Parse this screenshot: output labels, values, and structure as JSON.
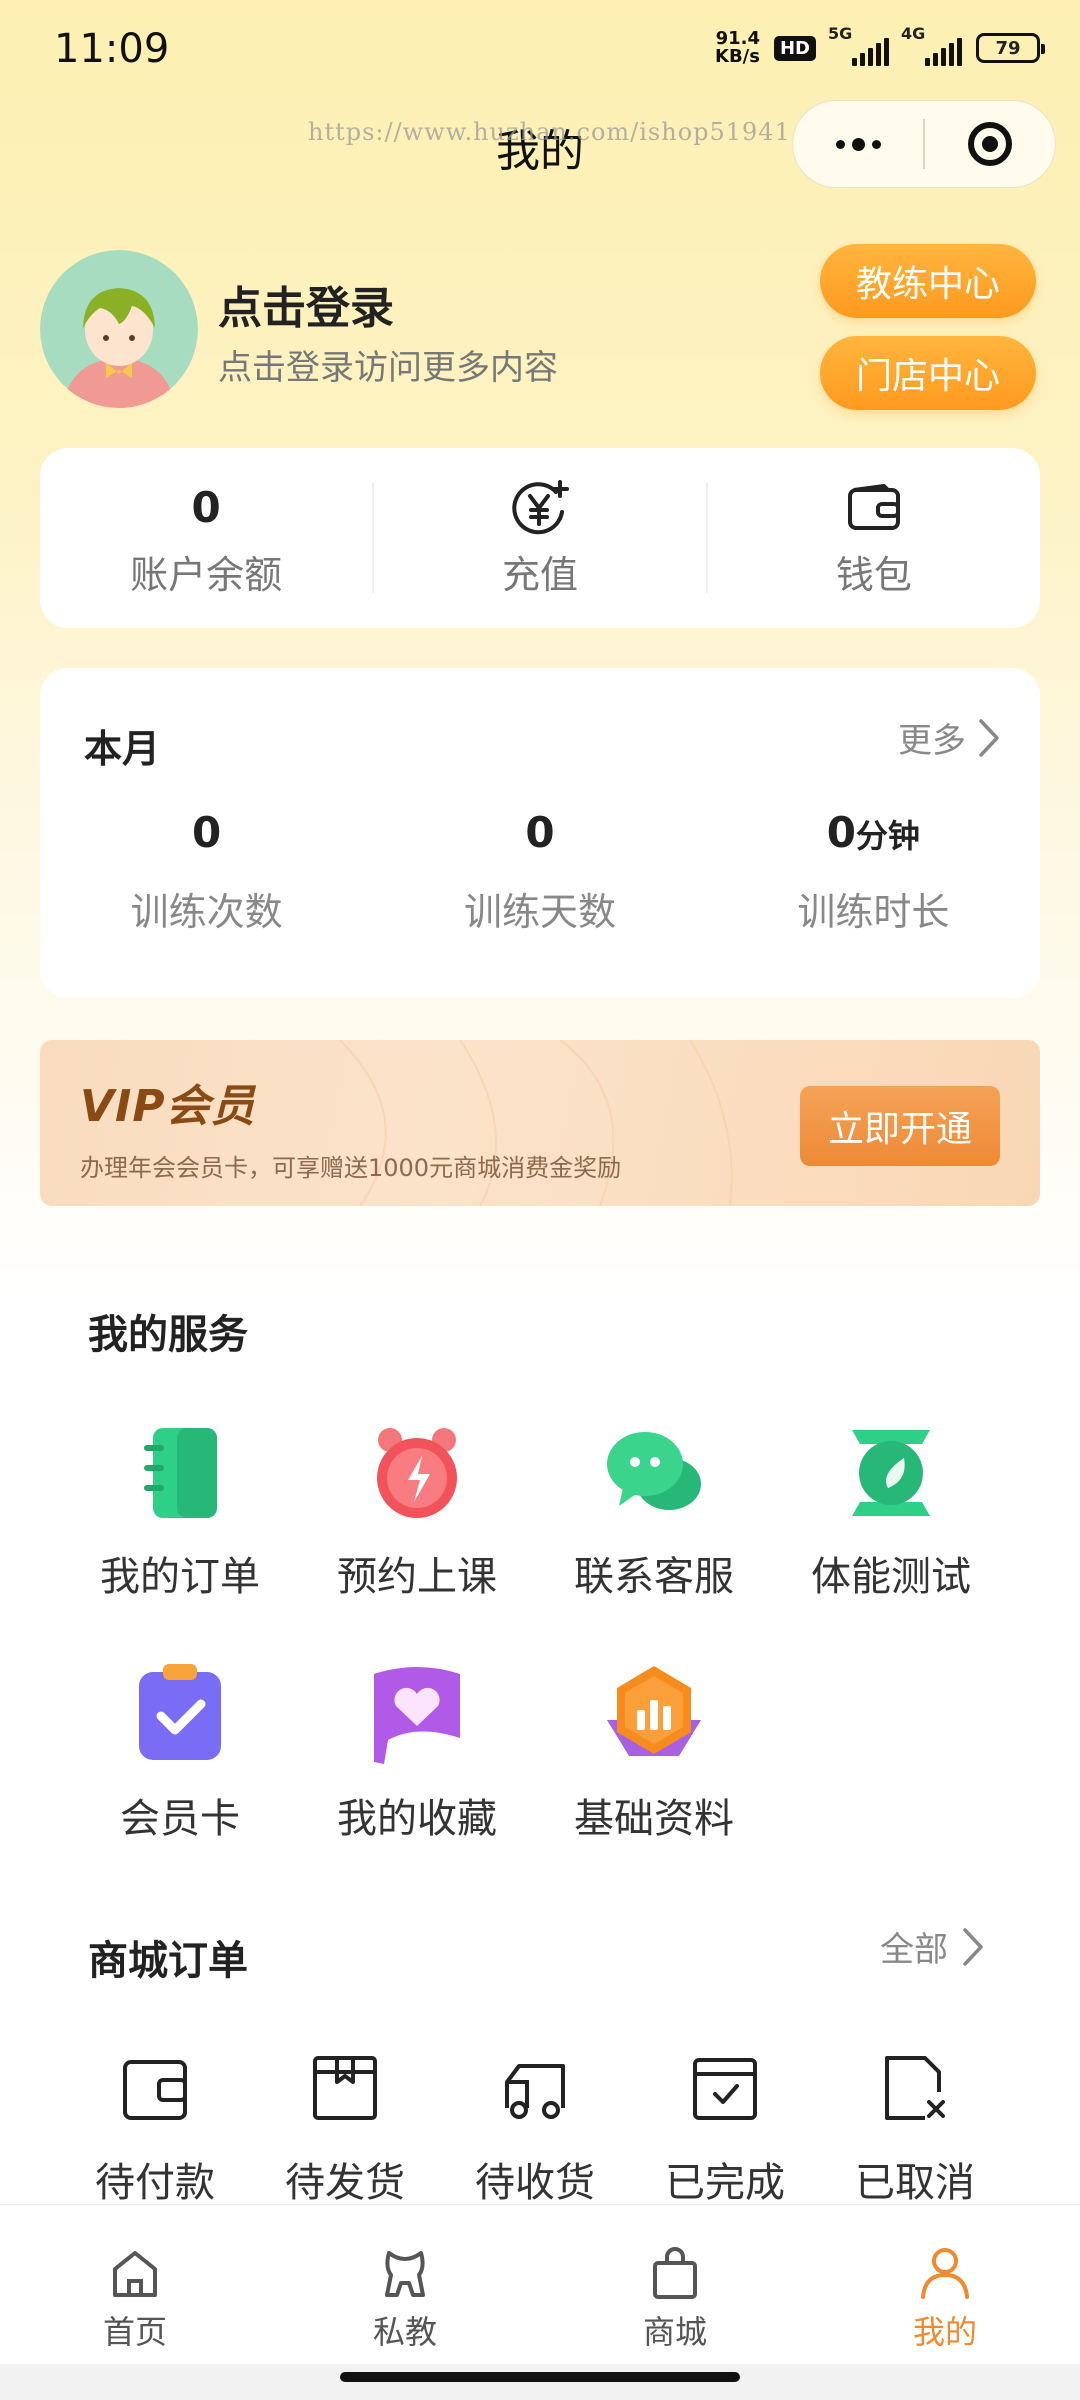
{
  "status_bar": {
    "time": "11:09",
    "net_speed_value": "91.4",
    "net_speed_unit": "KB/s",
    "hd_badge": "HD",
    "signal1_label": "5G",
    "signal2_label": "4G",
    "battery": "79"
  },
  "nav": {
    "title": "我的",
    "watermark": "https://www.huzhan.com/ishop51941"
  },
  "profile": {
    "login_title": "点击登录",
    "login_subtitle": "点击登录访问更多内容",
    "coach_center": "教练中心",
    "store_center": "门店中心"
  },
  "wallet": {
    "balance_value": "0",
    "balance_label": "账户余额",
    "recharge_label": "充值",
    "wallet_label": "钱包"
  },
  "month": {
    "title": "本月",
    "more": "更多",
    "stats": [
      {
        "value": "0",
        "unit": "",
        "label": "训练次数"
      },
      {
        "value": "0",
        "unit": "",
        "label": "训练天数"
      },
      {
        "value": "0",
        "unit": "分钟",
        "label": "训练时长"
      }
    ]
  },
  "vip": {
    "title": "VIP会员",
    "description": "办理年会会员卡，可享赠送1000元商城消费金奖励",
    "button": "立即开通"
  },
  "services": {
    "title": "我的服务",
    "items": [
      {
        "label": "我的订单",
        "icon": "notebook-icon"
      },
      {
        "label": "预约上课",
        "icon": "alarm-clock-icon"
      },
      {
        "label": "联系客服",
        "icon": "chat-bubble-icon"
      },
      {
        "label": "体能测试",
        "icon": "scale-icon"
      },
      {
        "label": "会员卡",
        "icon": "clipboard-check-icon"
      },
      {
        "label": "我的收藏",
        "icon": "heart-flag-icon"
      },
      {
        "label": "基础资料",
        "icon": "bar-chart-badge-icon"
      }
    ]
  },
  "orders": {
    "title": "商城订单",
    "all": "全部",
    "items": [
      {
        "label": "待付款",
        "icon": "wallet-icon"
      },
      {
        "label": "待发货",
        "icon": "package-icon"
      },
      {
        "label": "待收货",
        "icon": "truck-icon"
      },
      {
        "label": "已完成",
        "icon": "calendar-check-icon"
      },
      {
        "label": "已取消",
        "icon": "document-cancel-icon"
      }
    ]
  },
  "tabbar": {
    "items": [
      {
        "label": "首页",
        "icon": "home-icon"
      },
      {
        "label": "私教",
        "icon": "coach-icon"
      },
      {
        "label": "商城",
        "icon": "shopping-bag-icon"
      },
      {
        "label": "我的",
        "icon": "user-icon"
      }
    ],
    "active_color": "#f08a2e"
  },
  "colors": {
    "accent_orange": "#ff9a1f",
    "vip_brown": "#8a4a16",
    "service_green": "#2ecf86",
    "service_red": "#f2525a",
    "service_purple": "#8a63ff"
  }
}
